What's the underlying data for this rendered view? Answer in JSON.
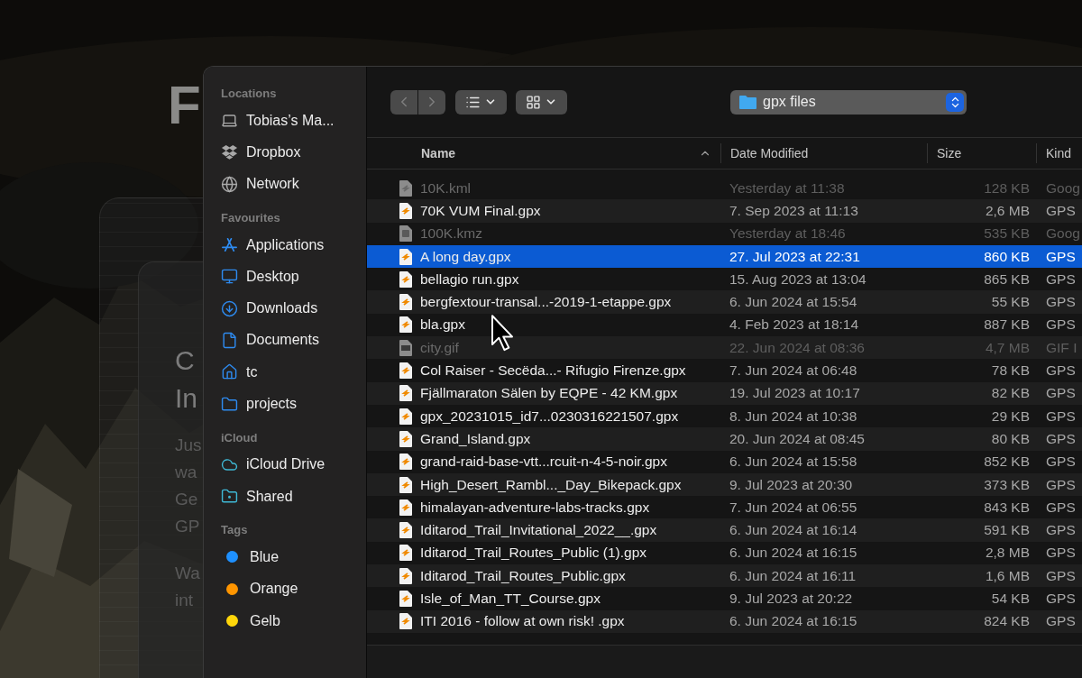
{
  "background": {
    "heading": "F",
    "card_title_lines": [
      "C",
      "In"
    ],
    "card_body_lines": [
      "Jus",
      "wa",
      "Ge",
      "GP"
    ],
    "card_body2_lines": [
      "Wa",
      "int"
    ]
  },
  "sidebar": {
    "sections": [
      {
        "title": "Locations",
        "items": [
          {
            "kind": "laptop",
            "label": "Tobias’s Ma..."
          },
          {
            "kind": "dropbox",
            "label": "Dropbox"
          },
          {
            "kind": "network",
            "label": "Network"
          }
        ]
      },
      {
        "title": "Favourites",
        "items": [
          {
            "kind": "applications",
            "label": "Applications"
          },
          {
            "kind": "desktop",
            "label": "Desktop"
          },
          {
            "kind": "downloads",
            "label": "Downloads"
          },
          {
            "kind": "documents",
            "label": "Documents"
          },
          {
            "kind": "home",
            "label": "tc"
          },
          {
            "kind": "folder",
            "label": "projects"
          }
        ]
      },
      {
        "title": "iCloud",
        "items": [
          {
            "kind": "cloud",
            "label": "iCloud Drive"
          },
          {
            "kind": "shared",
            "label": "Shared"
          }
        ]
      },
      {
        "title": "Tags",
        "items": [
          {
            "kind": "tag",
            "label": "Blue",
            "color": "#1e90ff"
          },
          {
            "kind": "tag",
            "label": "Orange",
            "color": "#ff9500"
          },
          {
            "kind": "tag",
            "label": "Gelb",
            "color": "#ffd60a"
          }
        ]
      }
    ]
  },
  "toolbar": {
    "back_disabled": true,
    "forward_disabled": true,
    "path": "gpx files"
  },
  "columns": [
    {
      "label": "Name",
      "sorted": true
    },
    {
      "label": "Date Modified",
      "sorted": false
    },
    {
      "label": "Size",
      "sorted": false
    },
    {
      "label": "Kind",
      "sorted": false
    }
  ],
  "rows": [
    {
      "kind": "kml",
      "name": "10K.kml",
      "date": "Yesterday at 11:38",
      "size": "128 KB",
      "type": "Goog",
      "disabled": true,
      "selected": false
    },
    {
      "kind": "gpx",
      "name": "70K VUM Final.gpx",
      "date": "7. Sep 2023 at 11:13",
      "size": "2,6 MB",
      "type": "GPS",
      "disabled": false,
      "selected": false
    },
    {
      "kind": "kmz",
      "name": "100K.kmz",
      "date": "Yesterday at 18:46",
      "size": "535 KB",
      "type": "Goog",
      "disabled": true,
      "selected": false
    },
    {
      "kind": "gpx",
      "name": "A long day.gpx",
      "date": "27. Jul 2023 at 22:31",
      "size": "860 KB",
      "type": "GPS",
      "disabled": false,
      "selected": true
    },
    {
      "kind": "gpx",
      "name": "bellagio run.gpx",
      "date": "15. Aug 2023 at 13:04",
      "size": "865 KB",
      "type": "GPS",
      "disabled": false,
      "selected": false
    },
    {
      "kind": "gpx",
      "name": "bergfextour-transal...-2019-1-etappe.gpx",
      "date": "6. Jun 2024 at 15:54",
      "size": "55 KB",
      "type": "GPS",
      "disabled": false,
      "selected": false
    },
    {
      "kind": "gpx",
      "name": "bla.gpx",
      "date": "4. Feb 2023 at 18:14",
      "size": "887 KB",
      "type": "GPS",
      "disabled": false,
      "selected": false
    },
    {
      "kind": "gif",
      "name": "city.gif",
      "date": "22. Jun 2024 at 08:36",
      "size": "4,7 MB",
      "type": "GIF I",
      "disabled": true,
      "selected": false
    },
    {
      "kind": "gpx",
      "name": "Col Raiser - Secëda...- Rifugio Firenze.gpx",
      "date": "7. Jun 2024 at 06:48",
      "size": "78 KB",
      "type": "GPS",
      "disabled": false,
      "selected": false
    },
    {
      "kind": "gpx",
      "name": "Fjällmaraton Sälen by EQPE - 42 KM.gpx",
      "date": "19. Jul 2023 at 10:17",
      "size": "82 KB",
      "type": "GPS",
      "disabled": false,
      "selected": false
    },
    {
      "kind": "gpx",
      "name": "gpx_20231015_id7...0230316221507.gpx",
      "date": "8. Jun 2024 at 10:38",
      "size": "29 KB",
      "type": "GPS",
      "disabled": false,
      "selected": false
    },
    {
      "kind": "gpx",
      "name": "Grand_Island.gpx",
      "date": "20. Jun 2024 at 08:45",
      "size": "80 KB",
      "type": "GPS",
      "disabled": false,
      "selected": false
    },
    {
      "kind": "gpx",
      "name": "grand-raid-base-vtt...rcuit-n-4-5-noir.gpx",
      "date": "6. Jun 2024 at 15:58",
      "size": "852 KB",
      "type": "GPS",
      "disabled": false,
      "selected": false
    },
    {
      "kind": "gpx",
      "name": "High_Desert_Rambl..._Day_Bikepack.gpx",
      "date": "9. Jul 2023 at 20:30",
      "size": "373 KB",
      "type": "GPS",
      "disabled": false,
      "selected": false
    },
    {
      "kind": "gpx",
      "name": "himalayan-adventure-labs-tracks.gpx",
      "date": "7. Jun 2024 at 06:55",
      "size": "843 KB",
      "type": "GPS",
      "disabled": false,
      "selected": false
    },
    {
      "kind": "gpx",
      "name": "Iditarod_Trail_Invitational_2022__.gpx",
      "date": "6. Jun 2024 at 16:14",
      "size": "591 KB",
      "type": "GPS",
      "disabled": false,
      "selected": false
    },
    {
      "kind": "gpx",
      "name": "Iditarod_Trail_Routes_Public (1).gpx",
      "date": "6. Jun 2024 at 16:15",
      "size": "2,8 MB",
      "type": "GPS",
      "disabled": false,
      "selected": false
    },
    {
      "kind": "gpx",
      "name": "Iditarod_Trail_Routes_Public.gpx",
      "date": "6. Jun 2024 at 16:11",
      "size": "1,6 MB",
      "type": "GPS",
      "disabled": false,
      "selected": false
    },
    {
      "kind": "gpx",
      "name": "Isle_of_Man_TT_Course.gpx",
      "date": "9. Jul 2023 at 20:22",
      "size": "54 KB",
      "type": "GPS",
      "disabled": false,
      "selected": false
    },
    {
      "kind": "gpx",
      "name": "ITI 2016 - follow at own risk! .gpx",
      "date": "6. Jun 2024 at 16:15",
      "size": "824 KB",
      "type": "GPS",
      "disabled": false,
      "selected": false
    }
  ]
}
